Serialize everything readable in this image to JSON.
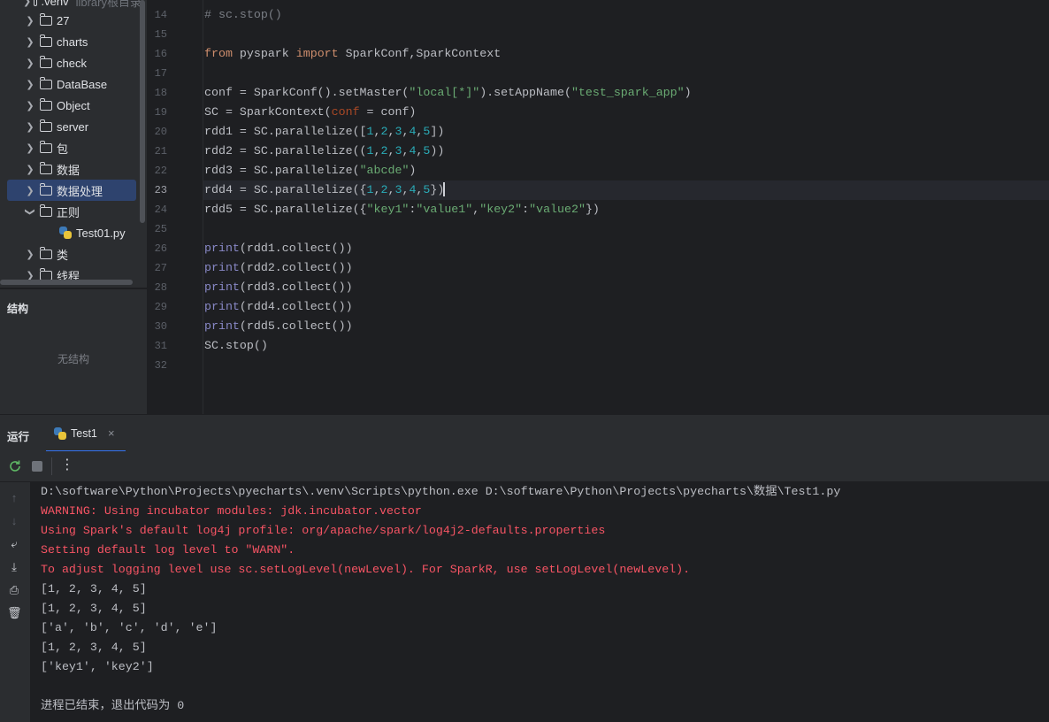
{
  "project_tree": {
    "items": [
      {
        "label": ".venv",
        "note": "library根目录",
        "expanded": false
      },
      {
        "label": "27",
        "expanded": false
      },
      {
        "label": "charts",
        "expanded": false
      },
      {
        "label": "check",
        "expanded": false
      },
      {
        "label": "DataBase",
        "expanded": false
      },
      {
        "label": "Object",
        "expanded": false
      },
      {
        "label": "server",
        "expanded": false
      },
      {
        "label": "包",
        "expanded": false
      },
      {
        "label": "数据",
        "expanded": false
      },
      {
        "label": "数据处理",
        "expanded": false,
        "selected": true
      },
      {
        "label": "正则",
        "expanded": true
      },
      {
        "label": "Test01.py",
        "type": "python-file"
      },
      {
        "label": "类",
        "expanded": false
      },
      {
        "label": "线程",
        "expanded": false
      }
    ]
  },
  "structure": {
    "title": "结构",
    "empty_text": "无结构"
  },
  "editor": {
    "active_line": 23,
    "lines": [
      {
        "n": 14,
        "text": "# sc.stop()"
      },
      {
        "n": 15,
        "text": ""
      },
      {
        "n": 16,
        "text": "from pyspark import SparkConf,SparkContext"
      },
      {
        "n": 17,
        "text": ""
      },
      {
        "n": 18,
        "text": "conf = SparkConf().setMaster(\"local[*]\").setAppName(\"test_spark_app\")"
      },
      {
        "n": 19,
        "text": "SC = SparkContext(conf = conf)"
      },
      {
        "n": 20,
        "text": "rdd1 = SC.parallelize([1,2,3,4,5])"
      },
      {
        "n": 21,
        "text": "rdd2 = SC.parallelize((1,2,3,4,5))"
      },
      {
        "n": 22,
        "text": "rdd3 = SC.parallelize(\"abcde\")"
      },
      {
        "n": 23,
        "text": "rdd4 = SC.parallelize({1,2,3,4,5})"
      },
      {
        "n": 24,
        "text": "rdd5 = SC.parallelize({\"key1\":\"value1\",\"key2\":\"value2\"})"
      },
      {
        "n": 25,
        "text": ""
      },
      {
        "n": 26,
        "text": "print(rdd1.collect())"
      },
      {
        "n": 27,
        "text": "print(rdd2.collect())"
      },
      {
        "n": 28,
        "text": "print(rdd3.collect())"
      },
      {
        "n": 29,
        "text": "print(rdd4.collect())"
      },
      {
        "n": 30,
        "text": "print(rdd5.collect())"
      },
      {
        "n": 31,
        "text": "SC.stop()"
      },
      {
        "n": 32,
        "text": ""
      }
    ]
  },
  "run_panel": {
    "label": "运行",
    "tab_label": "Test1",
    "tab_close": "×",
    "toolbar": {
      "rerun_icon": "rerun-icon",
      "stop_icon": "stop-icon",
      "more_icon": "more-vertical-icon"
    },
    "side_icons": [
      "arrow-up-icon",
      "arrow-down-icon",
      "soft-wrap-icon",
      "scroll-to-end-icon",
      "print-icon",
      "trash-icon"
    ],
    "console_lines": [
      {
        "text": "D:\\software\\Python\\Projects\\pyecharts\\.venv\\Scripts\\python.exe D:\\software\\Python\\Projects\\pyecharts\\数据\\Test1.py",
        "kind": "normal"
      },
      {
        "text": "WARNING: Using incubator modules: jdk.incubator.vector",
        "kind": "error"
      },
      {
        "text": "Using Spark's default log4j profile: org/apache/spark/log4j2-defaults.properties",
        "kind": "error"
      },
      {
        "text": "Setting default log level to \"WARN\".",
        "kind": "error"
      },
      {
        "text": "To adjust logging level use sc.setLogLevel(newLevel). For SparkR, use setLogLevel(newLevel).",
        "kind": "error"
      },
      {
        "text": "[1, 2, 3, 4, 5]",
        "kind": "normal"
      },
      {
        "text": "[1, 2, 3, 4, 5]",
        "kind": "normal"
      },
      {
        "text": "['a', 'b', 'c', 'd', 'e']",
        "kind": "normal"
      },
      {
        "text": "[1, 2, 3, 4, 5]",
        "kind": "normal"
      },
      {
        "text": "['key1', 'key2']",
        "kind": "normal"
      },
      {
        "text": "",
        "kind": "normal"
      },
      {
        "text": "进程已结束，退出代码为 0",
        "kind": "normal"
      }
    ]
  },
  "colors": {
    "keyword": "#cf8e6d",
    "string": "#6aab73",
    "number": "#2aacb8",
    "builtin": "#8888c6",
    "error": "#f75464",
    "selection": "#2e436e",
    "accent": "#3574f0"
  }
}
